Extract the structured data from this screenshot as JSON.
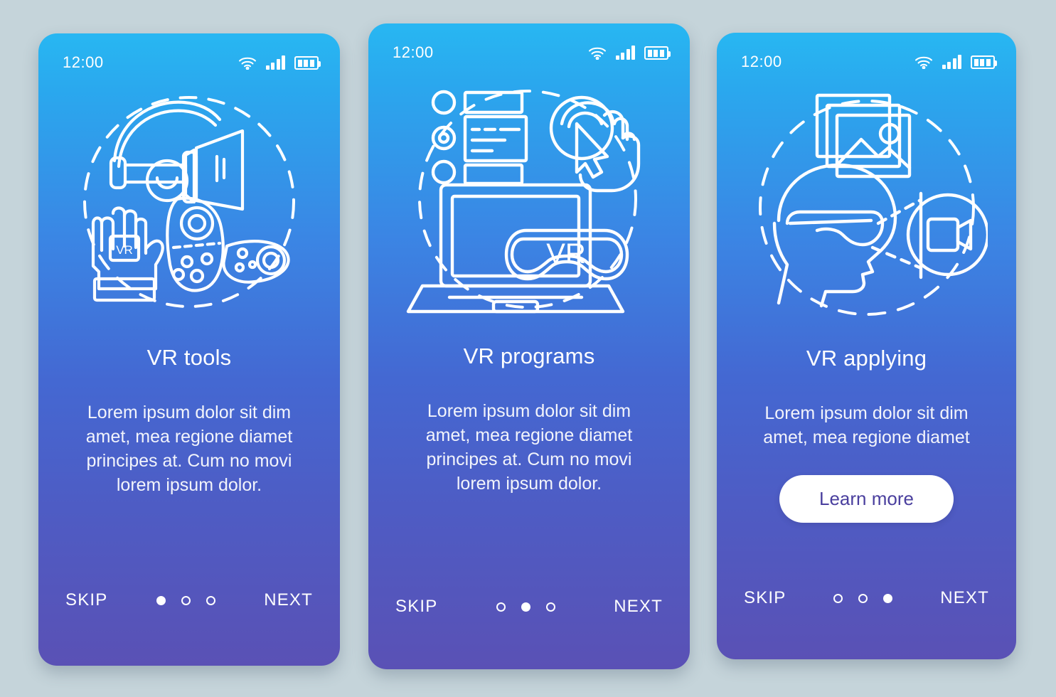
{
  "background_color": "#c5d4da",
  "gradient": {
    "top": "#28b7f2",
    "mid": "#4468d2",
    "bottom": "#5a51b5"
  },
  "cta_color": "#4a3f9e",
  "shared": {
    "status": {
      "time": "12:00",
      "wifi_icon": "wifi-icon",
      "signal_icon": "signal-bars-icon",
      "battery_icon": "battery-icon"
    },
    "nav": {
      "skip_label": "SKIP",
      "next_label": "NEXT"
    }
  },
  "screens": [
    {
      "id": "vr-tools",
      "title": "VR tools",
      "description": "Lorem ipsum dolor sit dim amet, mea regione diamet principes at. Cum no movi lorem ipsum dolor.",
      "illustration": "vr-headset-glove-controllers-illustration",
      "illustration_label": "VR",
      "active_dot": 0,
      "dot_count": 3,
      "cta": null
    },
    {
      "id": "vr-programs",
      "title": "VR programs",
      "description": "Lorem ipsum dolor sit dim amet, mea regione diamet principes at. Cum no movi lorem ipsum dolor.",
      "illustration": "laptop-vr-goggles-tap-illustration",
      "illustration_label": "VR",
      "active_dot": 1,
      "dot_count": 3,
      "cta": null
    },
    {
      "id": "vr-applying",
      "title": "VR applying",
      "description": "Lorem ipsum dolor sit dim amet, mea regione diamet",
      "illustration": "head-vr-glasses-photos-camera-illustration",
      "illustration_label": "",
      "active_dot": 2,
      "dot_count": 3,
      "cta": "Learn more"
    }
  ]
}
